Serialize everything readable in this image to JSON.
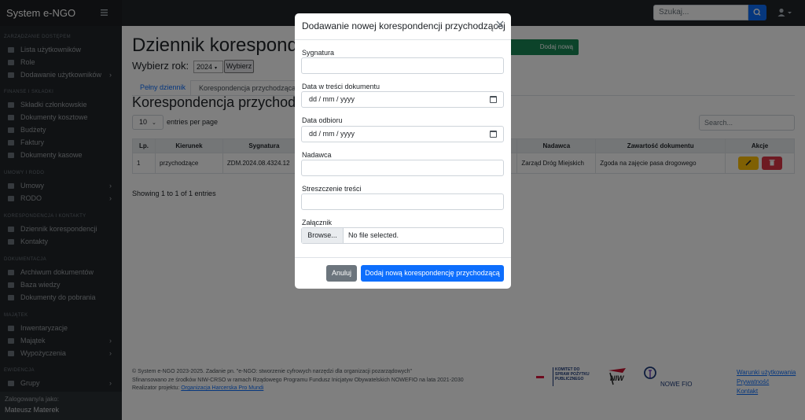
{
  "app": {
    "brand": "System e-NGO",
    "search_placeholder": "Szukaj..."
  },
  "sidebar": {
    "sections": [
      {
        "heading": "ZARZĄDZANIE DOSTĘPEM",
        "items": [
          {
            "label": "Lista użytkowników",
            "icon": "users-icon"
          },
          {
            "label": "Role",
            "icon": "roles-icon"
          },
          {
            "label": "Dodawanie użytkowników",
            "icon": "user-add-icon",
            "chevron": true
          }
        ]
      },
      {
        "heading": "FINANSE I SKŁADKI",
        "items": [
          {
            "label": "Składki członkowskie",
            "icon": "document-icon"
          },
          {
            "label": "Dokumenty kosztowe",
            "icon": "document-icon"
          },
          {
            "label": "Budżety",
            "icon": "budget-icon"
          },
          {
            "label": "Faktury",
            "icon": "document-icon"
          },
          {
            "label": "Dokumenty kasowe",
            "icon": "document-icon"
          }
        ]
      },
      {
        "heading": "UMOWY I RODO",
        "items": [
          {
            "label": "Umowy",
            "icon": "document-icon",
            "chevron": true
          },
          {
            "label": "RODO",
            "icon": "shield-icon",
            "chevron": true
          }
        ]
      },
      {
        "heading": "KORESPONDENCJA I KONTAKTY",
        "items": [
          {
            "label": "Dziennik korespondencji",
            "icon": "journal-icon"
          },
          {
            "label": "Kontakty",
            "icon": "contacts-icon"
          }
        ]
      },
      {
        "heading": "DOKUMENTACJA",
        "items": [
          {
            "label": "Archiwum dokumentów",
            "icon": "archive-icon"
          },
          {
            "label": "Baza wiedzy",
            "icon": "book-icon"
          },
          {
            "label": "Dokumenty do pobrania",
            "icon": "download-icon"
          }
        ]
      },
      {
        "heading": "MAJĄTEK",
        "items": [
          {
            "label": "Inwentaryzacje",
            "icon": "list-icon"
          },
          {
            "label": "Majątek",
            "icon": "box-icon",
            "chevron": true
          },
          {
            "label": "Wypożyczenia",
            "icon": "loan-icon",
            "chevron": true
          }
        ]
      },
      {
        "heading": "EWIDENCJA",
        "items": [
          {
            "label": "Grupy",
            "icon": "group-icon",
            "chevron": true
          }
        ]
      }
    ],
    "logged_as_label": "Zalogowany/a jako:",
    "user_name": "Mateusz Materek"
  },
  "main": {
    "page_title": "Dziennik korespondencji",
    "outgoing_button": "Dodaj nową korespondencję wychodzącą",
    "year_label": "Wybierz rok:",
    "year_value": "2024",
    "year_button": "Wybierz",
    "tabs": [
      {
        "label": "Pełny dziennik",
        "active": false
      },
      {
        "label": "Korespondencja przychodząca",
        "active": true
      }
    ],
    "section_title": "Korespondencja przychodząca",
    "entries_value": "10",
    "entries_label": "entries per page",
    "table_search_placeholder": "Search...",
    "table": {
      "headers": [
        "Lp.",
        "Kierunek",
        "Sygnatura",
        "Nadawca",
        "Zawartość dokumentu",
        "Akcje"
      ],
      "rows": [
        {
          "lp": "1",
          "kierunek": "przychodzące",
          "sygnatura": "ZDM.2024.08.4324.12",
          "nadawca": "Zarząd Dróg Miejskich",
          "zawartosc": "Zgoda na zajęcie pasa drogowego"
        }
      ]
    },
    "showing": "Showing 1 to 1 of 1 entries"
  },
  "footer": {
    "line1": "© System e-NGO 2023-2025. Zadanie pn. \"e-NGO: stworzenie cyfrowych narzędzi dla organizacji pozarządowych\"",
    "line2": "Sfinansowano ze środków NIW-CRSO w ramach Rządowego Programu Fundusz Inicjatyw Obywatelskich NOWEFIO na lata 2021-2030",
    "line3_prefix": "Realizator projektu:",
    "line3_link": "Organizacja Harcerska Pro Mundi",
    "links": [
      "Warunki użytkowania",
      "Prywatność",
      "Kontakt"
    ],
    "logo_committee": "KOMITET DO SPRAW POŻYTKU PUBLICZNEGO",
    "logo_niw": "NIW",
    "logo_fio": "NOWE FIO"
  },
  "modal": {
    "title": "Dodawanie nowej korespondencji przychodzącej",
    "fields": {
      "signature_label": "Sygnatura",
      "signature_value": "",
      "doc_date_label": "Data w treści dokumentu",
      "doc_date_placeholder": "dd / mm / yyyy",
      "receipt_date_label": "Data odbioru",
      "receipt_date_placeholder": "dd / mm / yyyy",
      "sender_label": "Nadawca",
      "sender_value": "",
      "summary_label": "Streszczenie treści",
      "summary_value": "",
      "attachment_label": "Załącznik",
      "browse_button": "Browse...",
      "no_file": "No file selected."
    },
    "cancel_button": "Anuluj",
    "submit_button": "Dodaj nową korespondencję przychodzącą"
  },
  "colors": {
    "primary": "#0d6efd",
    "success": "#198754",
    "warning": "#ffc107",
    "danger": "#dc3545",
    "secondary": "#6c757d",
    "sidebar": "#212529"
  }
}
